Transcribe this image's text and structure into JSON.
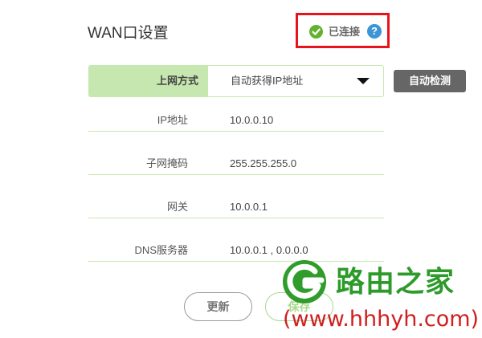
{
  "page": {
    "title": "WAN口设置"
  },
  "status": {
    "text": "已连接",
    "help": "?",
    "icon": "check-circle-icon",
    "color": "#62b22f",
    "highlight_color": "#e8131b"
  },
  "connection_mode": {
    "label": "上网方式",
    "value": "自动获得IP地址",
    "icon": "dropdown-arrow-icon"
  },
  "detect_button": {
    "label": "自动检测"
  },
  "info_rows": [
    {
      "label": "IP地址",
      "value": "10.0.0.10"
    },
    {
      "label": "子网掩码",
      "value": "255.255.255.0"
    },
    {
      "label": "网关",
      "value": "10.0.0.1"
    },
    {
      "label": "DNS服务器",
      "value": "10.0.0.1 , 0.0.0.0"
    }
  ],
  "actions": {
    "refresh_label": "更新",
    "save_label": "保存"
  },
  "watermark": {
    "brand": "路由之家",
    "url": "(www.hhhyh.com)"
  },
  "colors": {
    "accent_green": "#c6e7b0",
    "button_gray": "#666666"
  }
}
